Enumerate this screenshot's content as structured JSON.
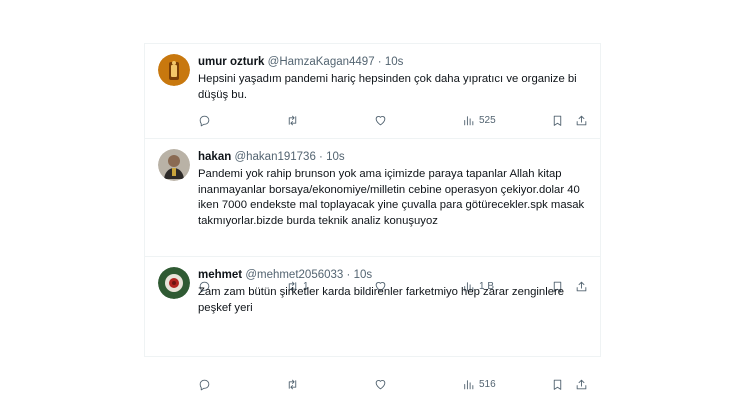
{
  "tweets": [
    {
      "name": "umur ozturk",
      "handle": "@HamzaKagan4497",
      "dot": "·",
      "time": "10s",
      "text": "Hepsini yaşadım pandemi hariç hepsinden çok daha yıpratıcı ve organize bi düşüş bu.",
      "retweets": "",
      "views": "525"
    },
    {
      "name": "hakan",
      "handle": "@hakan191736",
      "dot": "·",
      "time": "10s",
      "text": "Pandemi yok rahip brunson yok ama içimizde paraya tapanlar Allah kitap inanmayanlar borsaya/ekonomiye/milletin cebine operasyon çekiyor.dolar 40 iken 7000 endekste mal toplayacak yine çuvalla para götürecekler.spk masak takmıyorlar.bizde burda teknik analiz konuşuyoz",
      "retweets": "1",
      "views": "1 B"
    },
    {
      "name": "mehmet",
      "handle": "@mehmet2056033",
      "dot": "·",
      "time": "10s",
      "text": "Zam zam bütün şirketler karda bildirenler farketmiyo hep zarar zenginlere peşkef yeri",
      "retweets": "",
      "views": "516"
    }
  ],
  "icons": {
    "reply": "reply-icon",
    "retweet": "retweet-icon",
    "like": "like-icon",
    "views": "views-icon",
    "bookmark": "bookmark-icon",
    "share": "share-icon"
  },
  "colors": {
    "text": "#0f1419",
    "secondary": "#536471",
    "border": "#eff3f4"
  }
}
